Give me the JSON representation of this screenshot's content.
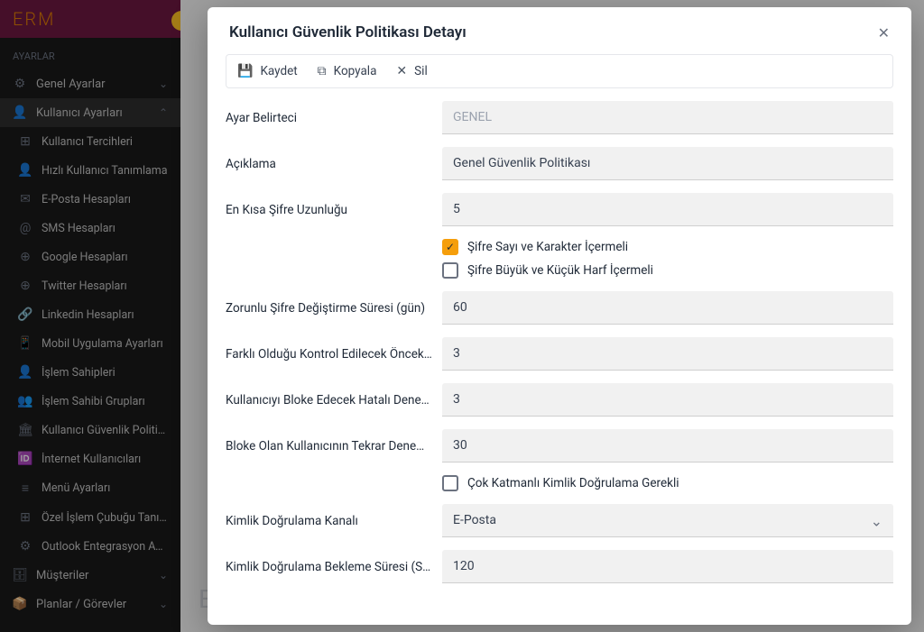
{
  "brand": "ERM",
  "sidebar": {
    "section_label": "AYARLAR",
    "items": [
      {
        "icon": "⚙",
        "label": "Genel Ayarlar",
        "chev": "⌄"
      },
      {
        "icon": "👤",
        "label": "Kullanıcı Ayarları",
        "chev": "⌃",
        "active": true
      }
    ],
    "sub": [
      {
        "icon": "⊞",
        "label": "Kullanıcı Tercihleri"
      },
      {
        "icon": "👤",
        "label": "Hızlı Kullanıcı Tanımlama"
      },
      {
        "icon": "✉",
        "label": "E-Posta Hesapları"
      },
      {
        "icon": "@",
        "label": "SMS Hesapları"
      },
      {
        "icon": "⊕",
        "label": "Google Hesapları"
      },
      {
        "icon": "⊕",
        "label": "Twitter Hesapları"
      },
      {
        "icon": "🔗",
        "label": "Linkedin Hesapları"
      },
      {
        "icon": "📱",
        "label": "Mobil Uygulama Ayarları"
      },
      {
        "icon": "👤",
        "label": "İşlem Sahipleri"
      },
      {
        "icon": "👥",
        "label": "İşlem Sahibi Grupları"
      },
      {
        "icon": "🏛",
        "label": "Kullanıcı Güvenlik Politikala"
      },
      {
        "icon": "🆔",
        "label": "İnternet Kullanıcıları"
      },
      {
        "icon": "≡",
        "label": "Menü Ayarları"
      },
      {
        "icon": "⊞",
        "label": "Özel İşlem Çubuğu Tanımla"
      },
      {
        "icon": "⚙",
        "label": "Outlook Entegrasyon Ayarl"
      }
    ],
    "bottom": [
      {
        "icon": "🗄",
        "label": "Müşteriler",
        "chev": "⌄"
      },
      {
        "icon": "📦",
        "label": "Planlar / Görevler",
        "chev": "⌄"
      }
    ]
  },
  "modal": {
    "title": "Kullanıcı Güvenlik Politikası Detayı",
    "toolbar": {
      "save": "Kaydet",
      "copy": "Kopyala",
      "delete": "Sil"
    },
    "fields": {
      "spec_label": "Ayar Belirteci",
      "spec_value": "GENEL",
      "desc_label": "Açıklama",
      "desc_value": "Genel Güvenlik Politikası",
      "minlen_label": "En Kısa Şifre Uzunluğu",
      "minlen_value": "5",
      "chk1_label": "Şifre Sayı ve Karakter İçermeli",
      "chk2_label": "Şifre Büyük ve Küçük Harf İçermeli",
      "force_label": "Zorunlu Şifre Değiştirme Süresi (gün)",
      "force_value": "60",
      "prev_label": "Farklı Olduğu Kontrol Edilecek Önceki Şi...",
      "prev_value": "3",
      "block_label": "Kullanıcıyı Bloke Edecek Hatalı Deneme...",
      "block_value": "3",
      "retry_label": "Bloke Olan Kullanıcının Tekrar Deneme İ...",
      "retry_value": "30",
      "mfa_label": "Çok Katmanlı Kimlik Doğrulama Gerekli",
      "channel_label": "Kimlik Doğrulama Kanalı",
      "channel_value": "E-Posta",
      "wait_label": "Kimlik Doğrulama Bekleme Süresi (Sani...",
      "wait_value": "120"
    }
  }
}
